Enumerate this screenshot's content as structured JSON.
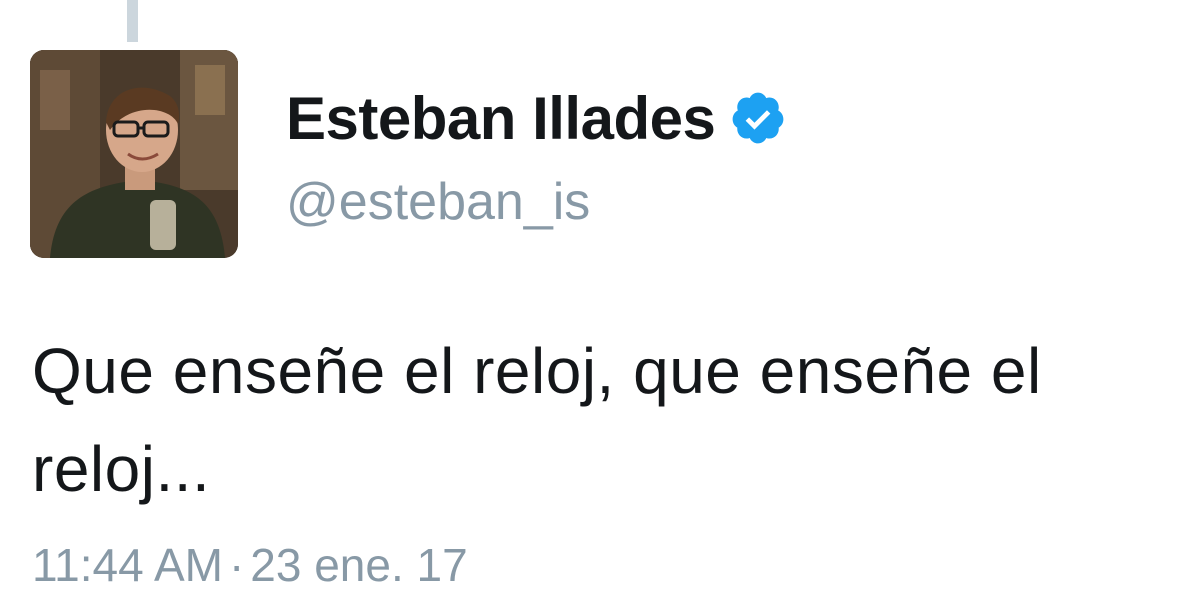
{
  "tweet": {
    "author": {
      "display_name": "Esteban Illades",
      "handle": "@esteban_is",
      "verified": true,
      "avatar_icon": "profile-photo"
    },
    "text": "Que enseñe el reloj, que enseñe el reloj...",
    "time": "11:44 AM",
    "separator": "·",
    "date": "23 ene. 17"
  },
  "colors": {
    "name": "#14171a",
    "secondary": "#8899a6",
    "verified": "#1da1f2",
    "thread_line": "#ccd6dd"
  }
}
